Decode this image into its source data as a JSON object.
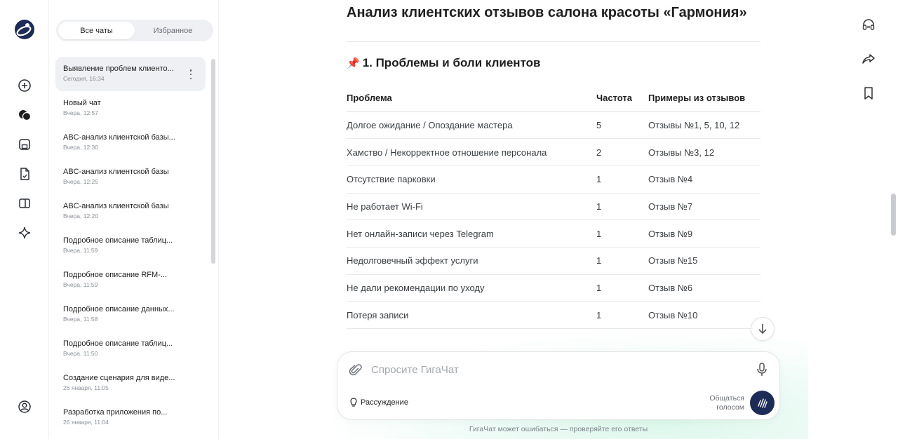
{
  "sidebar": {
    "tabs": [
      "Все чаты",
      "Избранное"
    ],
    "chats": [
      {
        "title": "Выявление проблем клиенто...",
        "time": "Сегодня, 16:34"
      },
      {
        "title": "Новый чат",
        "time": "Вчера, 12:57"
      },
      {
        "title": "ABC-анализ клиентской базы...",
        "time": "Вчера, 12:30"
      },
      {
        "title": "ABC-анализ клиентской базы",
        "time": "Вчера, 12:25"
      },
      {
        "title": "ABC-анализ клиентской базы",
        "time": "Вчера, 12:20"
      },
      {
        "title": "Подробное описание таблиц...",
        "time": "Вчера, 11:59"
      },
      {
        "title": "Подробное описание RFM-...",
        "time": "Вчера, 11:59"
      },
      {
        "title": "Подробное описание данных...",
        "time": "Вчера, 11:58"
      },
      {
        "title": "Подробное описание таблиц...",
        "time": "Вчера, 11:50"
      },
      {
        "title": "Создание сценария для виде...",
        "time": "26 января, 11:05"
      },
      {
        "title": "Разработка приложения по...",
        "time": "26 января, 11:04"
      }
    ]
  },
  "main": {
    "title": "Анализ клиентских отзывов салона красоты «Гармония»",
    "section_icon": "📌",
    "section_title": "1. Проблемы и боли клиентов",
    "table": {
      "headers": [
        "Проблема",
        "Частота",
        "Примеры из отзывов"
      ],
      "rows": [
        [
          "Долгое ожидание / Опоздание мастера",
          "5",
          "Отзывы №1, 5, 10, 12"
        ],
        [
          "Хамство / Некорректное отношение персонала",
          "2",
          "Отзывы №3, 12"
        ],
        [
          "Отсутствие парковки",
          "1",
          "Отзыв №4"
        ],
        [
          "Не работает Wi-Fi",
          "1",
          "Отзыв №7"
        ],
        [
          "Нет онлайн-записи через Telegram",
          "1",
          "Отзыв №9"
        ],
        [
          "Недолговечный эффект услуги",
          "1",
          "Отзыв №15"
        ],
        [
          "Не дали рекомендации по уходу",
          "1",
          "Отзыв №6"
        ],
        [
          "Потеря записи",
          "1",
          "Отзыв №10"
        ]
      ]
    }
  },
  "composer": {
    "placeholder": "Спросите ГигаЧат",
    "reasoning_label": "Рассуждение",
    "voice_label_line1": "Общаться",
    "voice_label_line2": "голосом"
  },
  "footer": {
    "disclaimer": "ГигаЧат может ошибаться — проверяйте его ответы"
  },
  "colors": {
    "accent_dark": "#1d2b57",
    "active_item_bg": "#eef0f3"
  }
}
